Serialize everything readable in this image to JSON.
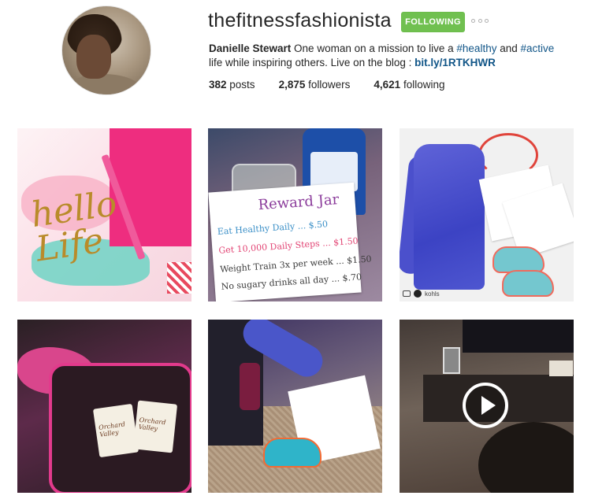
{
  "profile": {
    "username": "thefitnessfashionista",
    "follow_button_label": "FOLLOWING",
    "more_options_icon": "ellipsis-icon",
    "full_name": "Danielle Stewart",
    "bio_prefix": " One woman on a mission to live a ",
    "hashtag_1": "#healthy",
    "bio_middle": " and ",
    "hashtag_2": "#active",
    "bio_suffix": " life while inspiring others. Live on the blog : ",
    "bio_link": "bit.ly/1RTKHWR",
    "accent_color": "#70c050",
    "link_color": "#125688"
  },
  "stats": {
    "posts_count": "382",
    "posts_label": " posts",
    "followers_count": "2,875",
    "followers_label": " followers",
    "following_count": "4,621",
    "following_label": " following"
  },
  "posts": [
    {
      "name": "hello-life-post",
      "text": {
        "script": "hello Life"
      }
    },
    {
      "name": "reward-jar-post",
      "card": {
        "title": "Reward Jar",
        "line1": "Eat Healthy Daily ... $.50",
        "line2": "Get 10,000 Daily Steps ... $1.50",
        "line3": "Weight Train 3x per week ... $1.50",
        "line4": "No sugary drinks all day ... $.70"
      }
    },
    {
      "name": "kohls-jacket-post",
      "credit": "kohls"
    },
    {
      "name": "gym-bag-post",
      "packs": [
        "Orchard Valley",
        "Orchard Valley"
      ]
    },
    {
      "name": "planner-post"
    },
    {
      "name": "video-post",
      "play_icon": "play-icon"
    }
  ]
}
